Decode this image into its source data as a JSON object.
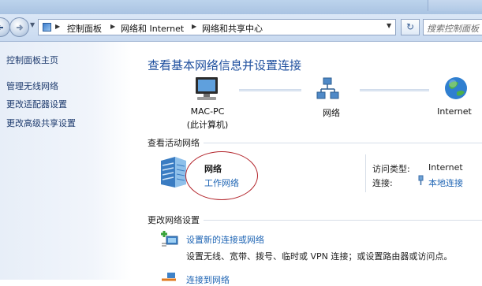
{
  "address": {
    "crumbs": [
      "控制面板",
      "网络和 Internet",
      "网络和共享中心"
    ],
    "search_placeholder": "搜索控制面板"
  },
  "sidebar": {
    "items": [
      {
        "label": "控制面板主页"
      },
      {
        "label": "管理无线网络"
      },
      {
        "label": "更改适配器设置"
      },
      {
        "label": "更改高级共享设置"
      }
    ]
  },
  "main": {
    "title": "查看基本网络信息并设置连接",
    "map": {
      "computer_name": "MAC-PC",
      "computer_sub": "(此计算机)",
      "network": "网络",
      "internet": "Internet"
    },
    "active_section": "查看活动网络",
    "active_network": {
      "name": "网络",
      "type": "工作网络",
      "access_label": "访问类型:",
      "access_value": "Internet",
      "conn_label": "连接:",
      "conn_value": "本地连接"
    },
    "change_section": "更改网络设置",
    "tasks": [
      {
        "title": "设置新的连接或网络",
        "desc": "设置无线、宽带、拨号、临时或 VPN 连接；或设置路由器或访问点。"
      },
      {
        "title": "连接到网络"
      }
    ]
  },
  "colors": {
    "link": "#1f65b4",
    "title": "#1e4f9e",
    "annotation": "#b2232a"
  }
}
